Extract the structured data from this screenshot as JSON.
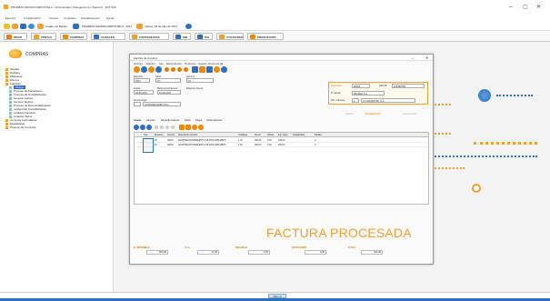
{
  "window": {
    "title": "PRUEBAS MICROCOMPOSTELA - Administrador (Delegación por Defecto) - DXT 009",
    "controls": [
      "–",
      "▢",
      "✕"
    ]
  },
  "menubar": [
    "Ejercicio",
    "Configuración",
    "Usuario",
    "Contextos",
    "Actualizaciones",
    "Ayuda"
  ],
  "toolbar": {
    "company_label": "Cuadro de Mando",
    "company_name": "PRUEBAS MICROCOMPOSTELA - 2017",
    "date": "martes, 18 de julio de 2017"
  },
  "nav": [
    {
      "label": "INICIO",
      "color": "#e67b00"
    },
    {
      "label": "VENTAS",
      "color": "#f0a030"
    },
    {
      "label": "COMPRAS",
      "color": "#f08a00"
    },
    {
      "label": "ALMACÉN",
      "color": "#2f6fbf"
    },
    {
      "label": "CONTABILIDAD",
      "color": "#f0a030"
    },
    {
      "label": "SMI",
      "color": "#2f6fbf"
    },
    {
      "label": "PGI",
      "color": "#2f6fbf"
    },
    {
      "label": "UTILIDADES",
      "color": "#f0a030"
    },
    {
      "label": "PRODUCCIÓN",
      "color": "#f08a00"
    }
  ],
  "sidebar": {
    "title": "COMPRAS",
    "tree": [
      {
        "label": "Ofertas",
        "indent": 0
      },
      {
        "label": "Pedidos",
        "indent": 0
      },
      {
        "label": "Albaranes",
        "indent": 0
      },
      {
        "label": "Abonos",
        "indent": 0
      },
      {
        "label": "Facturas",
        "indent": 0
      },
      {
        "label": "Nueva",
        "indent": 1,
        "selected": true
      },
      {
        "label": "Proceso de Facturación",
        "indent": 1
      },
      {
        "label": "Proceso de Contabilización",
        "indent": 1
      },
      {
        "label": "Generar Cobros",
        "indent": 1
      },
      {
        "label": "Generar Gastos",
        "indent": 1
      },
      {
        "label": "Proceso de Descontabilización",
        "indent": 1
      },
      {
        "label": "Incidencias Contabilización",
        "indent": 1
      },
      {
        "label": "Listados Facturas",
        "indent": 1
      },
      {
        "label": "Listados Varios",
        "indent": 1
      },
      {
        "label": "Compras Automáticas",
        "indent": 0
      },
      {
        "label": "Estadísticas",
        "indent": 0
      },
      {
        "label": "Proceso de Compras",
        "indent": 0
      }
    ]
  },
  "factura": {
    "title": "Factura de Compra",
    "menu": [
      "Archivo",
      "Edición",
      "Ver",
      "Movimientos",
      "Procesos",
      "Gestión Documental"
    ],
    "serie_label": "Ejercicio",
    "serie": "2017",
    "tipo_label": "Serie",
    "tipo": "FC",
    "numero_label": "Número",
    "numero": "10",
    "fecha_label": "Fecha",
    "fecha": "18-06-2017",
    "ref_label": "Referencia Factura",
    "ref": "10-06-2017",
    "pago_label": "Forma Pago",
    "pago": "CONTADO EFECTIVO",
    "iva_label": "Régimen Fiscal",
    "proveedor_label": "Proveedor",
    "proveedor": "00001",
    "nif_label": "NIF/CIF",
    "nif": "123456789",
    "rsocial_label": "R. Social",
    "rsocial": "DILIXED S.A.",
    "dirfac_label": "Dirn. Factura",
    "dirfac_num": "1",
    "dirfac": "C/ CASTRO 80, S.A.",
    "links": [
      "Asiento",
      "Contabilización",
      "Vencimientos"
    ],
    "tabs": [
      "Líneas",
      "Apuntes",
      "Domicilio Factura",
      "Datos",
      "Pagos",
      "Observaciones"
    ],
    "columns": [
      "Tipo",
      "Almacén",
      "Artículo",
      "Descripción Artículo",
      "Unidades",
      "Precio",
      "%Dcto",
      "Imp. Neto",
      "Nota/Pedido",
      "Partida"
    ],
    "rows": [
      [
        "",
        "40",
        "00002",
        "ADAPTADOR WIRELESS USB 300N 2DB MBPS",
        "1,00",
        "300,00",
        "0,00",
        "300,00",
        "",
        "0"
      ],
      [
        "",
        "40",
        "00002",
        "ADAPTADOR WIRELESS USB 300N 2DB MBPS",
        "1,00",
        "200,00",
        "0,00",
        "200,00",
        "",
        "0"
      ]
    ],
    "stamp": "FACTURA PROCESADA",
    "totals": [
      {
        "label": "B. IMPONIBLE",
        "value": "500,00"
      },
      {
        "label": "I.V.A.",
        "value": "21,00"
      },
      {
        "label": "RECARGO",
        "value": "0,00"
      },
      {
        "label": "DESCUENTO",
        "value": "0,00"
      },
      {
        "label": "TOTAL",
        "value": "521,00"
      }
    ]
  },
  "statusbar": {
    "page": "Pan. 0"
  }
}
